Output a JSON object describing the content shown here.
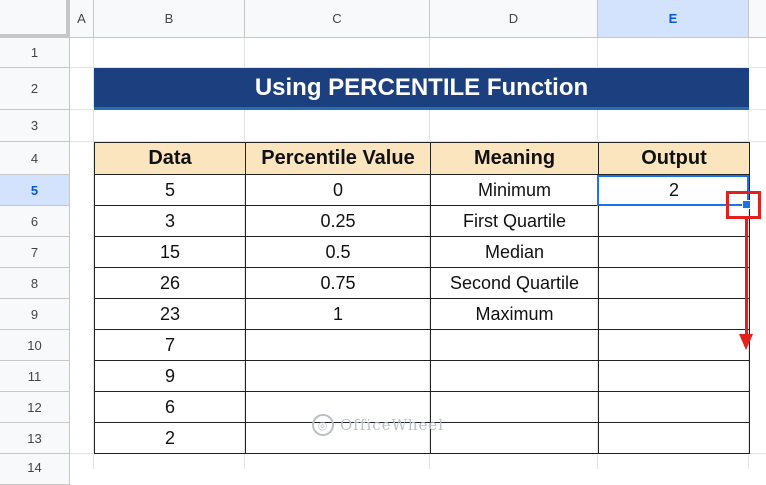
{
  "columns": [
    "A",
    "B",
    "C",
    "D",
    "E"
  ],
  "selected_column": "E",
  "rows": [
    "1",
    "2",
    "3",
    "4",
    "5",
    "6",
    "7",
    "8",
    "9",
    "10",
    "11",
    "12",
    "13",
    "14"
  ],
  "selected_row": "5",
  "title": "Using PERCENTILE Function",
  "table": {
    "headers": [
      "Data",
      "Percentile Value",
      "Meaning",
      "Output"
    ],
    "rows": [
      [
        "5",
        "0",
        "Minimum",
        "2"
      ],
      [
        "3",
        "0.25",
        "First Quartile",
        ""
      ],
      [
        "15",
        "0.5",
        "Median",
        ""
      ],
      [
        "26",
        "0.75",
        "Second Quartile",
        ""
      ],
      [
        "23",
        "1",
        "Maximum",
        ""
      ],
      [
        "7",
        "",
        "",
        ""
      ],
      [
        "9",
        "",
        "",
        ""
      ],
      [
        "6",
        "",
        "",
        ""
      ],
      [
        "2",
        "",
        "",
        ""
      ]
    ]
  },
  "watermark": "OfficeWheel",
  "colors": {
    "title_bg": "#1c3f80",
    "header_bg": "#fbe5bf",
    "selection": "#1a73e8",
    "annotation": "#e3201b"
  }
}
